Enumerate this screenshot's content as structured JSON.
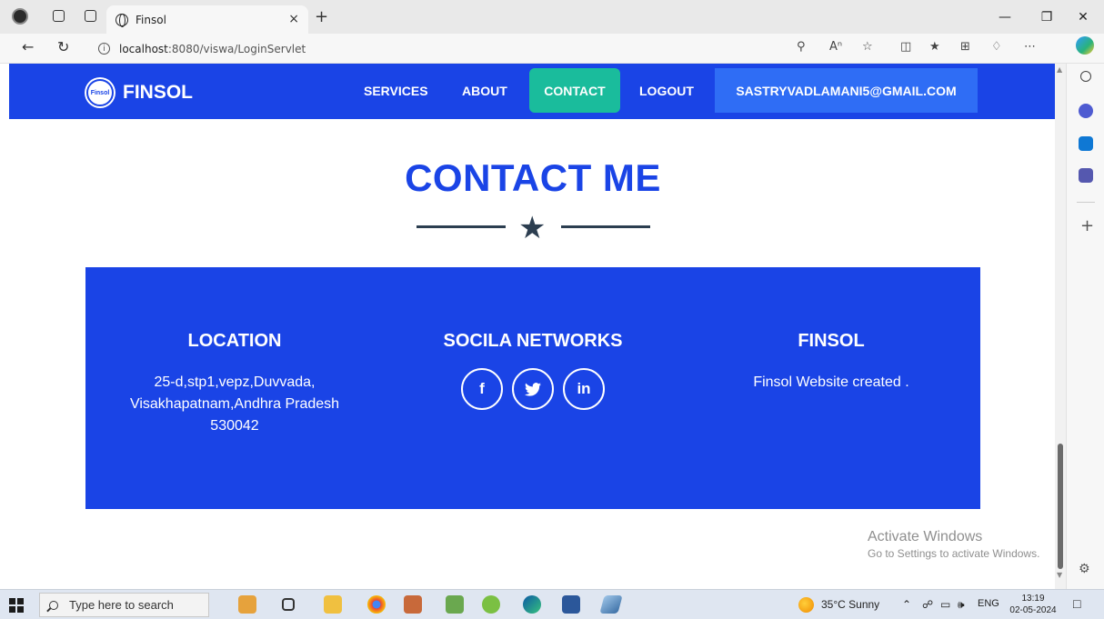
{
  "browser": {
    "tab_title": "Finsol",
    "tab_close": "×",
    "new_tab": "+",
    "url_host": "localhost",
    "url_path": ":8080/viswa/LoginServlet",
    "info_icon": "i"
  },
  "navbar": {
    "brand_logo_text": "Finsol",
    "brand": "FINSOL",
    "links": {
      "services": "SERVICES",
      "about": "ABOUT",
      "contact": "CONTACT",
      "logout": "LOGOUT",
      "email": "SASTRYVADLAMANI5@GMAIL.COM"
    },
    "colors": {
      "bar": "#1a44e6",
      "active": "#1abc9c",
      "email_bg": "#2f6df5"
    }
  },
  "section": {
    "title": "CONTACT ME",
    "divider_icon": "star-icon"
  },
  "footer": {
    "location": {
      "heading": "LOCATION",
      "line1": "25-d,stp1,vepz,Duvvada,",
      "line2": "Visakhapatnam,Andhra Pradesh",
      "line3": "530042"
    },
    "social": {
      "heading": "SOCILA NETWORKS",
      "facebook": "f",
      "twitter": "twitter-icon",
      "linkedin": "in"
    },
    "about": {
      "heading": "FINSOL",
      "text": "Finsol Website created ."
    }
  },
  "watermark": {
    "line1": "Activate Windows",
    "line2": "Go to Settings to activate Windows."
  },
  "taskbar": {
    "search_placeholder": "Type here to search",
    "weather": "35°C  Sunny",
    "lang": "ENG",
    "time": "13:19",
    "date": "02-05-2024"
  }
}
